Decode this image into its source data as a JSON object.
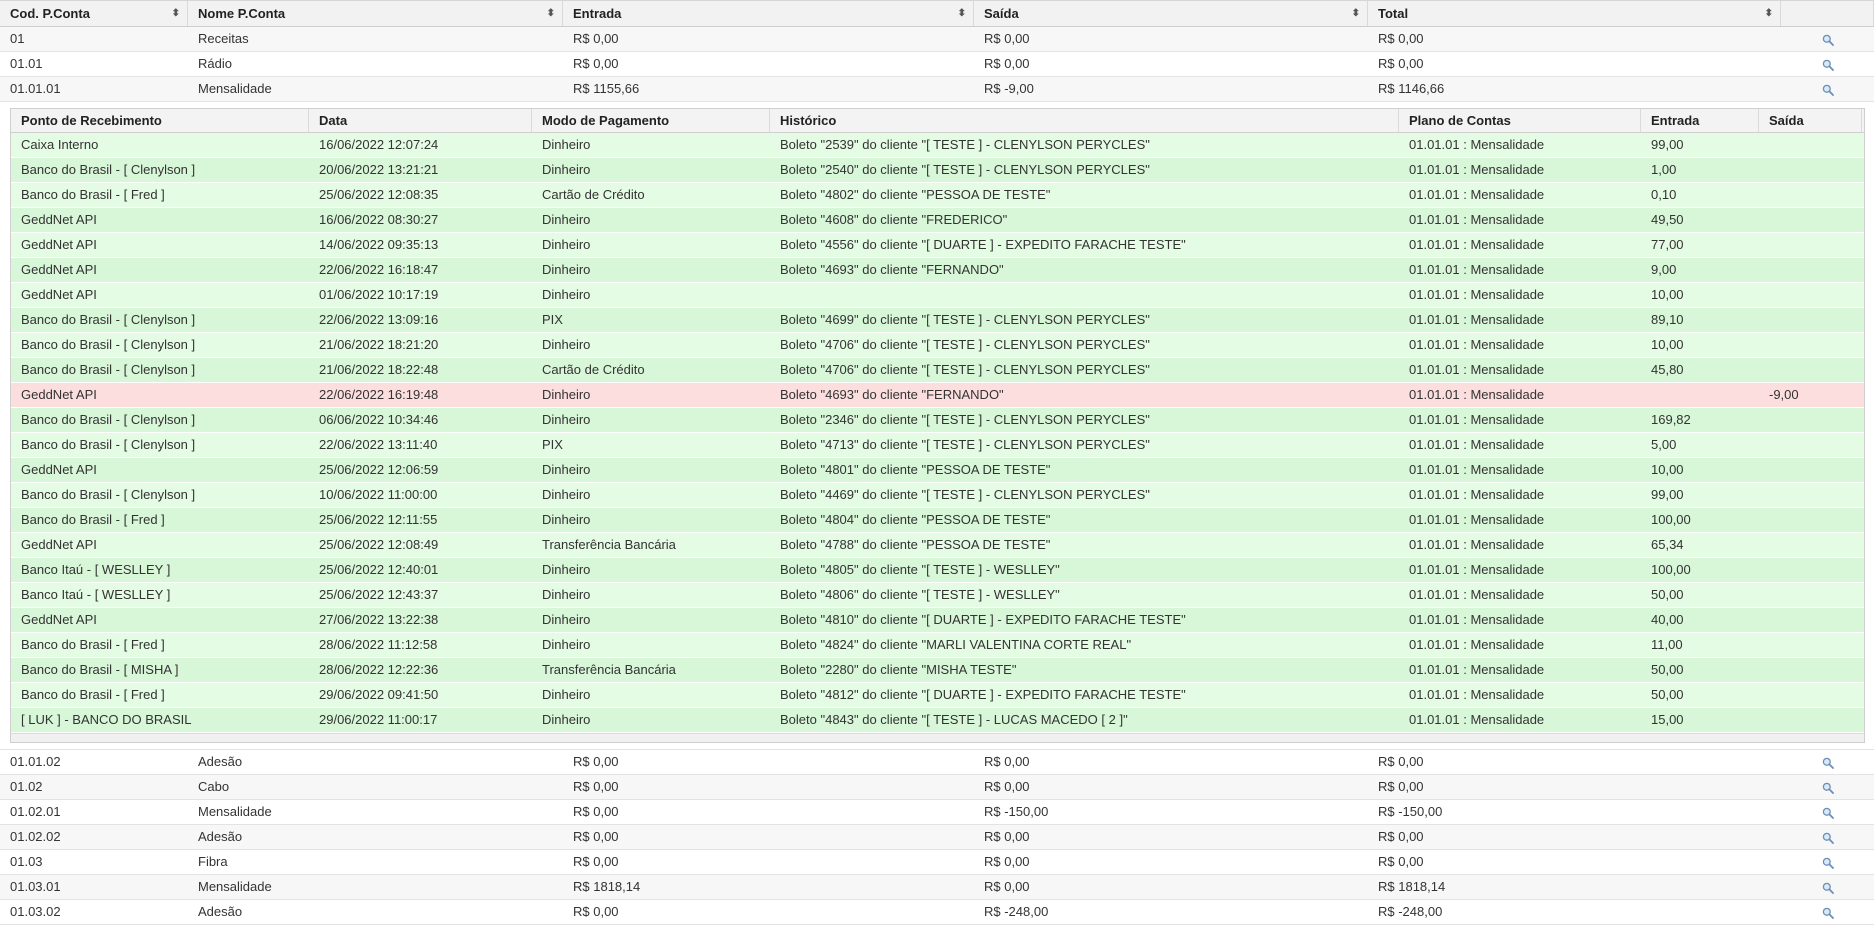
{
  "outer_headers": [
    "Cod. P.Conta",
    "Nome P.Conta",
    "Entrada",
    "Saída",
    "Total"
  ],
  "outer_rows_top": [
    {
      "cod": "01",
      "nome": "Receitas",
      "entrada": "R$ 0,00",
      "saida": "R$ 0,00",
      "total": "R$ 0,00"
    },
    {
      "cod": "01.01",
      "nome": "Rádio",
      "entrada": "R$ 0,00",
      "saida": "R$ 0,00",
      "total": "R$ 0,00"
    },
    {
      "cod": "01.01.01",
      "nome": "Mensalidade",
      "entrada": "R$ 1155,66",
      "saida": "R$ -9,00",
      "total": "R$ 1146,66"
    }
  ],
  "detail_headers": [
    "Ponto de Recebimento",
    "Data",
    "Modo de Pagamento",
    "Histórico",
    "Plano de Contas",
    "Entrada",
    "Saída"
  ],
  "detail_rows": [
    {
      "ponto": "Caixa Interno",
      "data": "16/06/2022 12:07:24",
      "modo": "Dinheiro",
      "historico": "Boleto \"2539\" do cliente \"[ TESTE ] - CLENYLSON PERYCLES\"",
      "plano": "01.01.01 : Mensalidade",
      "entrada": "99,00",
      "saida": ""
    },
    {
      "ponto": "Banco do Brasil - [ Clenylson ]",
      "data": "20/06/2022 13:21:21",
      "modo": "Dinheiro",
      "historico": "Boleto \"2540\" do cliente \"[ TESTE ] - CLENYLSON PERYCLES\"",
      "plano": "01.01.01 : Mensalidade",
      "entrada": "1,00",
      "saida": ""
    },
    {
      "ponto": "Banco do Brasil - [ Fred ]",
      "data": "25/06/2022 12:08:35",
      "modo": "Cartão de Crédito",
      "historico": "Boleto \"4802\" do cliente \"PESSOA DE TESTE\"",
      "plano": "01.01.01 : Mensalidade",
      "entrada": "0,10",
      "saida": ""
    },
    {
      "ponto": "GeddNet API",
      "data": "16/06/2022 08:30:27",
      "modo": "Dinheiro",
      "historico": "Boleto \"4608\" do cliente \"FREDERICO\"",
      "plano": "01.01.01 : Mensalidade",
      "entrada": "49,50",
      "saida": ""
    },
    {
      "ponto": "GeddNet API",
      "data": "14/06/2022 09:35:13",
      "modo": "Dinheiro",
      "historico": "Boleto \"4556\" do cliente \"[ DUARTE ] - EXPEDITO FARACHE TESTE\"",
      "plano": "01.01.01 : Mensalidade",
      "entrada": "77,00",
      "saida": ""
    },
    {
      "ponto": "GeddNet API",
      "data": "22/06/2022 16:18:47",
      "modo": "Dinheiro",
      "historico": "Boleto \"4693\" do cliente \"FERNANDO\"",
      "plano": "01.01.01 : Mensalidade",
      "entrada": "9,00",
      "saida": ""
    },
    {
      "ponto": "GeddNet API",
      "data": "01/06/2022 10:17:19",
      "modo": "Dinheiro",
      "historico": "",
      "plano": "01.01.01 : Mensalidade",
      "entrada": "10,00",
      "saida": ""
    },
    {
      "ponto": "Banco do Brasil - [ Clenylson ]",
      "data": "22/06/2022 13:09:16",
      "modo": "PIX",
      "historico": "Boleto \"4699\" do cliente \"[ TESTE ] - CLENYLSON PERYCLES\"",
      "plano": "01.01.01 : Mensalidade",
      "entrada": "89,10",
      "saida": ""
    },
    {
      "ponto": "Banco do Brasil - [ Clenylson ]",
      "data": "21/06/2022 18:21:20",
      "modo": "Dinheiro",
      "historico": "Boleto \"4706\" do cliente \"[ TESTE ] - CLENYLSON PERYCLES\"",
      "plano": "01.01.01 : Mensalidade",
      "entrada": "10,00",
      "saida": ""
    },
    {
      "ponto": "Banco do Brasil - [ Clenylson ]",
      "data": "21/06/2022 18:22:48",
      "modo": "Cartão de Crédito",
      "historico": "Boleto \"4706\" do cliente \"[ TESTE ] - CLENYLSON PERYCLES\"",
      "plano": "01.01.01 : Mensalidade",
      "entrada": "45,80",
      "saida": ""
    },
    {
      "ponto": "GeddNet API",
      "data": "22/06/2022 16:19:48",
      "modo": "Dinheiro",
      "historico": "Boleto \"4693\" do cliente \"FERNANDO\"",
      "plano": "01.01.01 : Mensalidade",
      "entrada": "",
      "saida": "-9,00",
      "negative": true
    },
    {
      "ponto": "Banco do Brasil - [ Clenylson ]",
      "data": "06/06/2022 10:34:46",
      "modo": "Dinheiro",
      "historico": "Boleto \"2346\" do cliente \"[ TESTE ] - CLENYLSON PERYCLES\"",
      "plano": "01.01.01 : Mensalidade",
      "entrada": "169,82",
      "saida": ""
    },
    {
      "ponto": "Banco do Brasil - [ Clenylson ]",
      "data": "22/06/2022 13:11:40",
      "modo": "PIX",
      "historico": "Boleto \"4713\" do cliente \"[ TESTE ] - CLENYLSON PERYCLES\"",
      "plano": "01.01.01 : Mensalidade",
      "entrada": "5,00",
      "saida": ""
    },
    {
      "ponto": "GeddNet API",
      "data": "25/06/2022 12:06:59",
      "modo": "Dinheiro",
      "historico": "Boleto \"4801\" do cliente \"PESSOA DE TESTE\"",
      "plano": "01.01.01 : Mensalidade",
      "entrada": "10,00",
      "saida": ""
    },
    {
      "ponto": "Banco do Brasil - [ Clenylson ]",
      "data": "10/06/2022 11:00:00",
      "modo": "Dinheiro",
      "historico": "Boleto \"4469\" do cliente \"[ TESTE ] - CLENYLSON PERYCLES\"",
      "plano": "01.01.01 : Mensalidade",
      "entrada": "99,00",
      "saida": ""
    },
    {
      "ponto": "Banco do Brasil - [ Fred ]",
      "data": "25/06/2022 12:11:55",
      "modo": "Dinheiro",
      "historico": "Boleto \"4804\" do cliente \"PESSOA DE TESTE\"",
      "plano": "01.01.01 : Mensalidade",
      "entrada": "100,00",
      "saida": ""
    },
    {
      "ponto": "GeddNet API",
      "data": "25/06/2022 12:08:49",
      "modo": "Transferência Bancária",
      "historico": "Boleto \"4788\" do cliente \"PESSOA DE TESTE\"",
      "plano": "01.01.01 : Mensalidade",
      "entrada": "65,34",
      "saida": ""
    },
    {
      "ponto": "Banco Itaú - [ WESLLEY ]",
      "data": "25/06/2022 12:40:01",
      "modo": "Dinheiro",
      "historico": "Boleto \"4805\" do cliente \"[ TESTE ] - WESLLEY\"",
      "plano": "01.01.01 : Mensalidade",
      "entrada": "100,00",
      "saida": ""
    },
    {
      "ponto": "Banco Itaú - [ WESLLEY ]",
      "data": "25/06/2022 12:43:37",
      "modo": "Dinheiro",
      "historico": "Boleto \"4806\" do cliente \"[ TESTE ] - WESLLEY\"",
      "plano": "01.01.01 : Mensalidade",
      "entrada": "50,00",
      "saida": ""
    },
    {
      "ponto": "GeddNet API",
      "data": "27/06/2022 13:22:38",
      "modo": "Dinheiro",
      "historico": "Boleto \"4810\" do cliente \"[ DUARTE ] - EXPEDITO FARACHE TESTE\"",
      "plano": "01.01.01 : Mensalidade",
      "entrada": "40,00",
      "saida": ""
    },
    {
      "ponto": "Banco do Brasil - [ Fred ]",
      "data": "28/06/2022 11:12:58",
      "modo": "Dinheiro",
      "historico": "Boleto \"4824\" do cliente \"MARLI VALENTINA CORTE REAL\"",
      "plano": "01.01.01 : Mensalidade",
      "entrada": "11,00",
      "saida": ""
    },
    {
      "ponto": "Banco do Brasil - [ MISHA ]",
      "data": "28/06/2022 12:22:36",
      "modo": "Transferência Bancária",
      "historico": "Boleto \"2280\" do cliente \"MISHA TESTE\"",
      "plano": "01.01.01 : Mensalidade",
      "entrada": "50,00",
      "saida": ""
    },
    {
      "ponto": "Banco do Brasil - [ Fred ]",
      "data": "29/06/2022 09:41:50",
      "modo": "Dinheiro",
      "historico": "Boleto \"4812\" do cliente \"[ DUARTE ] - EXPEDITO FARACHE TESTE\"",
      "plano": "01.01.01 : Mensalidade",
      "entrada": "50,00",
      "saida": ""
    },
    {
      "ponto": "[ LUK ] - BANCO DO BRASIL",
      "data": "29/06/2022 11:00:17",
      "modo": "Dinheiro",
      "historico": "Boleto \"4843\" do cliente \"[ TESTE ] - LUCAS MACEDO [ 2 ]\"",
      "plano": "01.01.01 : Mensalidade",
      "entrada": "15,00",
      "saida": ""
    }
  ],
  "outer_rows_bottom": [
    {
      "cod": "01.01.02",
      "nome": "Adesão",
      "entrada": "R$ 0,00",
      "saida": "R$ 0,00",
      "total": "R$ 0,00"
    },
    {
      "cod": "01.02",
      "nome": "Cabo",
      "entrada": "R$ 0,00",
      "saida": "R$ 0,00",
      "total": "R$ 0,00"
    },
    {
      "cod": "01.02.01",
      "nome": "Mensalidade",
      "entrada": "R$ 0,00",
      "saida": "R$ -150,00",
      "total": "R$ -150,00"
    },
    {
      "cod": "01.02.02",
      "nome": "Adesão",
      "entrada": "R$ 0,00",
      "saida": "R$ 0,00",
      "total": "R$ 0,00"
    },
    {
      "cod": "01.03",
      "nome": "Fibra",
      "entrada": "R$ 0,00",
      "saida": "R$ 0,00",
      "total": "R$ 0,00"
    },
    {
      "cod": "01.03.01",
      "nome": "Mensalidade",
      "entrada": "R$ 1818,14",
      "saida": "R$ 0,00",
      "total": "R$ 1818,14"
    },
    {
      "cod": "01.03.02",
      "nome": "Adesão",
      "entrada": "R$ 0,00",
      "saida": "R$ -248,00",
      "total": "R$ -248,00"
    }
  ],
  "colors": {
    "row_green_light": "#e4fbe4",
    "row_green": "#d8f6d8",
    "row_negative": "#fcdede"
  },
  "icons": {
    "sort": "sort-icon",
    "view": "magnifier-icon"
  }
}
